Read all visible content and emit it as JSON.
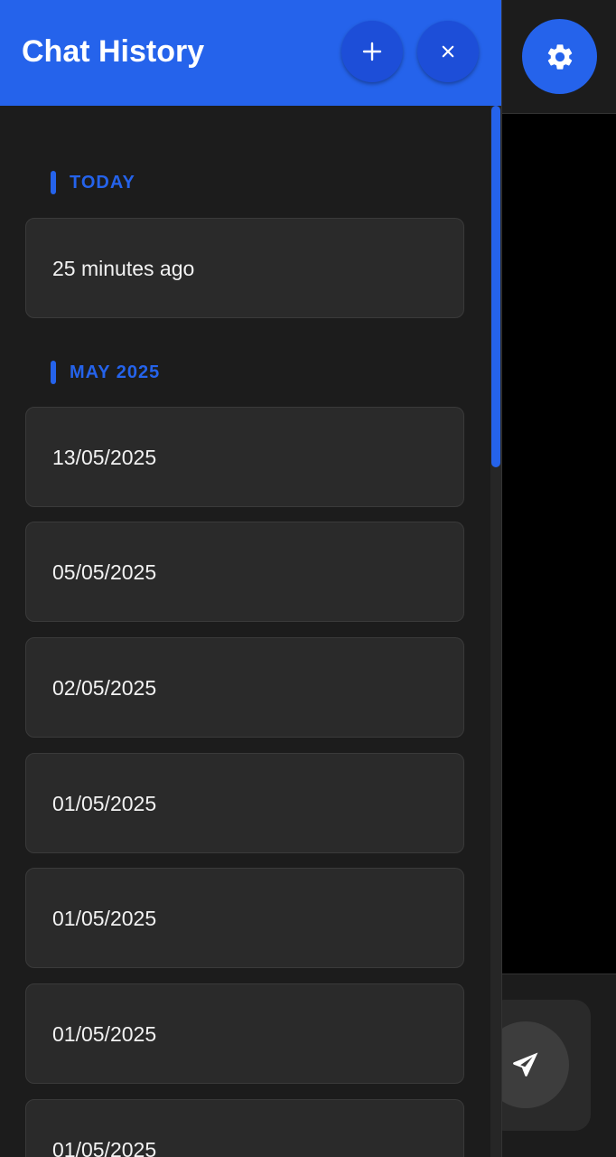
{
  "drawer": {
    "title": "Chat History",
    "new_chat_icon": "plus-icon",
    "close_icon": "close-icon"
  },
  "sections": [
    {
      "label": "TODAY",
      "items": [
        "25 minutes ago"
      ]
    },
    {
      "label": "MAY 2025",
      "items": [
        "13/05/2025",
        "05/05/2025",
        "02/05/2025",
        "01/05/2025",
        "01/05/2025",
        "01/05/2025",
        "01/05/2025"
      ]
    }
  ],
  "main": {
    "settings_icon": "gear-icon",
    "send_icon": "paper-plane-icon"
  },
  "colors": {
    "accent": "#2563eb",
    "accent_dark": "#1d4ed8",
    "drawer_bg": "#1c1c1c",
    "item_bg": "#2a2a2a",
    "text": "#f2f2f2"
  }
}
